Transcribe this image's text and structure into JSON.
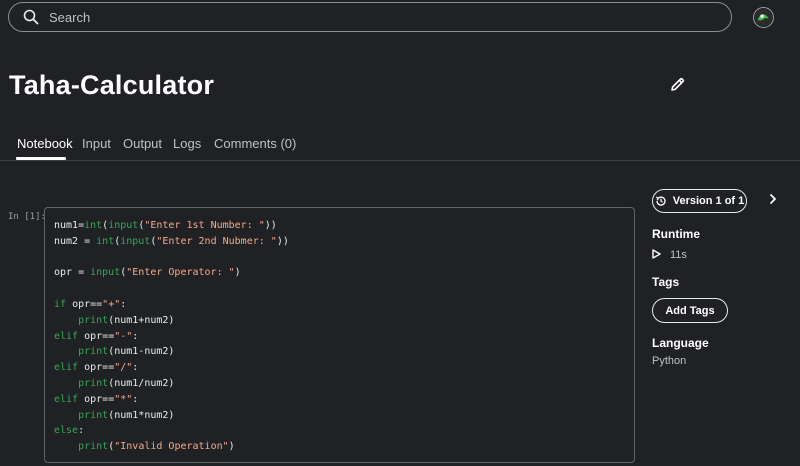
{
  "search": {
    "placeholder": "Search"
  },
  "notebook": {
    "title": "Taha-Calculator"
  },
  "tabs": [
    {
      "label": "Notebook",
      "active": true
    },
    {
      "label": "Input"
    },
    {
      "label": "Output"
    },
    {
      "label": "Logs"
    },
    {
      "label": "Comments (0)"
    }
  ],
  "cell": {
    "prompt": "In [1]:",
    "lines": [
      "num1=int(input(\"Enter 1st Number: \"))",
      "num2 = int(input(\"Enter 2nd Nubmer: \"))",
      "",
      "opr = input(\"Enter Operator: \")",
      "",
      "if opr==\"+\":",
      "    print(num1+num2)",
      "elif opr==\"-\":",
      "    print(num1-num2)",
      "elif opr==\"/\":",
      "    print(num1/num2)",
      "elif opr==\"*\":",
      "    print(num1*num2)",
      "else:",
      "    print(\"Invalid Operation\")"
    ]
  },
  "sidebar": {
    "version_label": "Version 1 of 1",
    "runtime_heading": "Runtime",
    "runtime_value": "11s",
    "tags_heading": "Tags",
    "add_tags_label": "Add Tags",
    "language_heading": "Language",
    "language_value": "Python"
  },
  "colors": {
    "background": "#202124",
    "keyword": "#34a853",
    "string": "#f4a98b",
    "text": "#e8eaed"
  },
  "icons": [
    "search-icon",
    "avatar",
    "pencil-icon",
    "history-icon",
    "chevron-right-icon",
    "play-icon"
  ]
}
